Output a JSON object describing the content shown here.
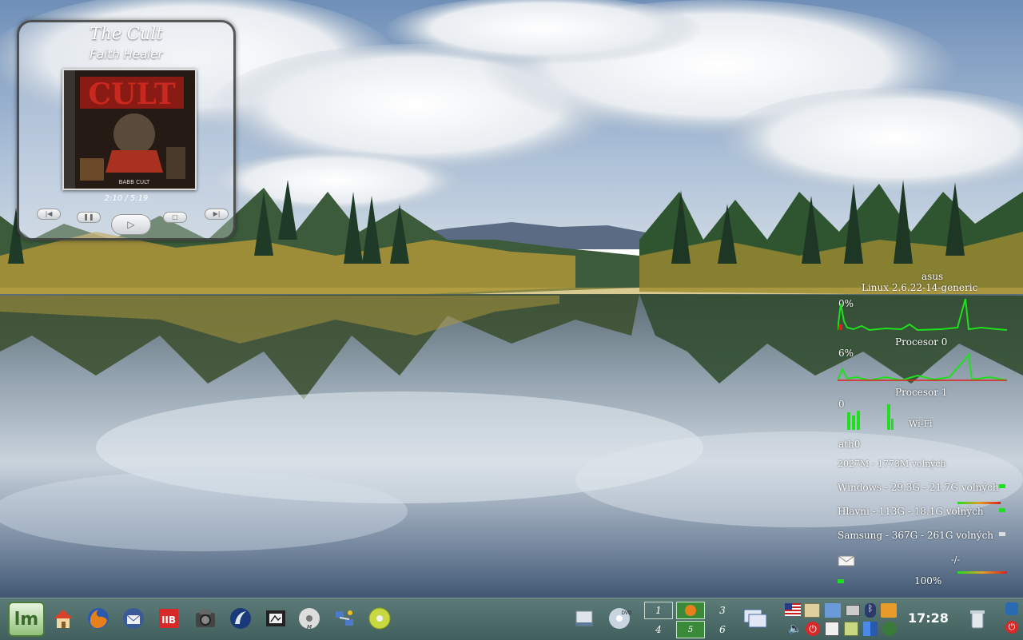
{
  "player": {
    "artist": "The Cult",
    "track": "Faith Healer",
    "time": "2:10 / 5:19",
    "album_art_text": "BABB CULT"
  },
  "conky": {
    "hostname": "asus",
    "kernel": "Linux 2.6.22-14-generic",
    "cpu0_percent": "0%",
    "cpu0_label": "Procesor 0",
    "cpu1_percent": "6%",
    "cpu1_label": "Procesor 1",
    "wifi_value": "0",
    "wifi_label": "Wi-Fi",
    "iface": "ath0",
    "memory": "2027M -  1773M volných",
    "disk_windows": "Windows - 29.3G - 21.7G volných",
    "disk_hlavni": "Hlavni - 113G - 18.1G volných",
    "disk_samsung": "Samsung - 367G - 261G volných",
    "mail_status": "-/-",
    "battery": "100%"
  },
  "taskbar": {
    "menu_icon": "mint-menu-icon",
    "launchers": [
      "home-folder-icon",
      "firefox-icon",
      "thunderbird-icon",
      "pdf-reader-icon",
      "image-viewer-icon",
      "network-icon",
      "video-editor-icon",
      "media-player-icon",
      "network-config-icon",
      "disc-burner-icon"
    ],
    "tasks": [
      "drive-icon",
      "dvd-icon"
    ],
    "pager": [
      "1",
      "2",
      "3",
      "4",
      "5",
      "6"
    ],
    "tray_icons": [
      "flag-icon",
      "image-icon",
      "network-tray-icon",
      "printer-icon",
      "bluetooth-icon",
      "folder-tray-icon",
      "volume-icon",
      "shutdown-icon",
      "notes-icon",
      "clipboard-icon",
      "signal-icon",
      "update-icon"
    ],
    "clock": "17:28",
    "trash_icon": "trash-icon",
    "lock_icon": "lock-icon",
    "logout_icon": "logout-icon"
  }
}
